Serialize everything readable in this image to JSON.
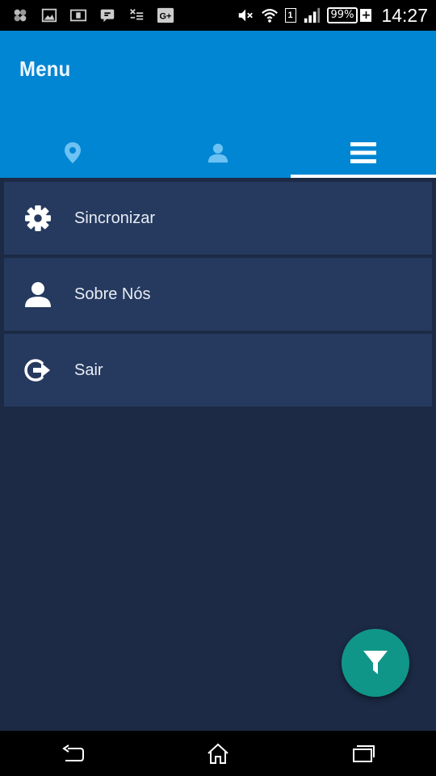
{
  "status_bar": {
    "notification_icons": [
      "apps-icon",
      "image-icon",
      "news-icon",
      "chat-icon",
      "missed-call-icon",
      "google-plus-icon"
    ],
    "sim_label": "1",
    "battery_percent": "99%",
    "battery_charging_symbol": "+",
    "clock": "14:27"
  },
  "header": {
    "title": "Menu",
    "tabs": [
      {
        "icon": "location-pin-icon",
        "active": false
      },
      {
        "icon": "user-icon",
        "active": false
      },
      {
        "icon": "hamburger-menu-icon",
        "active": true
      }
    ],
    "colors": {
      "background": "#0086d2",
      "inactive_tab_icon": "#6cc2f3",
      "active_tab_icon": "#ffffff"
    }
  },
  "menu": {
    "items": [
      {
        "label": "Sincronizar",
        "icon": "gear-icon"
      },
      {
        "label": "Sobre Nós",
        "icon": "user-icon"
      },
      {
        "label": "Sair",
        "icon": "logout-icon"
      }
    ]
  },
  "fab": {
    "icon": "filter-icon",
    "color": "#109688"
  },
  "nav_bar": {
    "buttons": [
      "back-icon",
      "home-icon",
      "recent-apps-icon"
    ]
  }
}
